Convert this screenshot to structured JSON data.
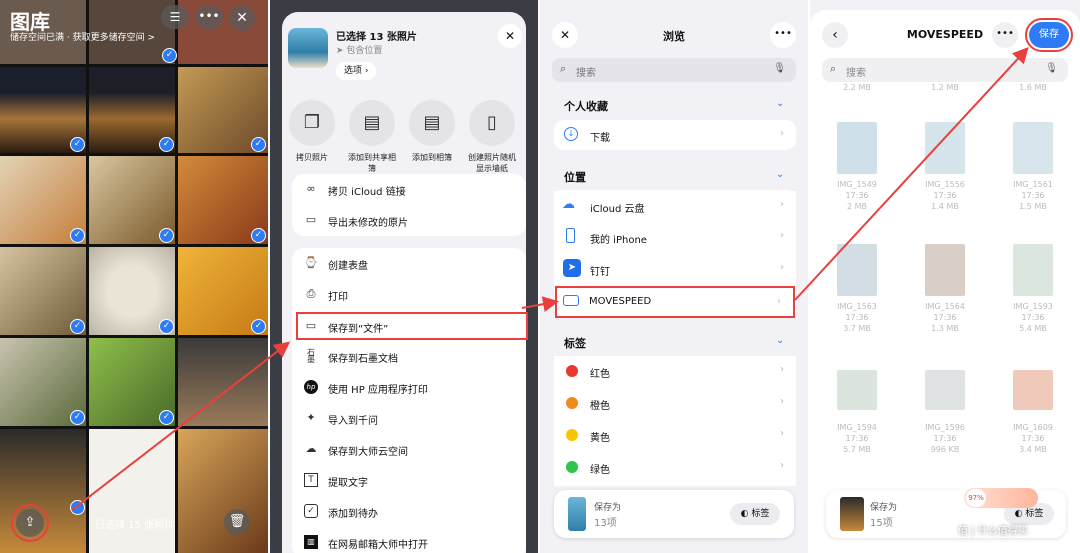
{
  "colors": {
    "accent": "#2e7bf6",
    "highlight": "#e9403d"
  },
  "gallery": {
    "title": "图库",
    "storage_notice": "储存空间已满 · 获取更多储存空间 >",
    "selected_label": "已选择 15 张照片",
    "menu_icon": "list-icon",
    "more_icon": "ellipsis-icon",
    "close_icon": "close-icon",
    "share_icon": "share-icon",
    "trash_icon": "trash-icon"
  },
  "share": {
    "title": "已选择 13 张照片",
    "location": "包含位置",
    "options_label": "选项",
    "actions": [
      {
        "label": "拷贝照片",
        "icon": "copy-icon"
      },
      {
        "label": "添加到共享相簿",
        "icon": "shared-album-icon"
      },
      {
        "label": "添加到相簿",
        "icon": "album-icon"
      },
      {
        "label": "创建照片随机显示墙纸",
        "icon": "phone-icon"
      }
    ],
    "group1": [
      "拷贝 iCloud 链接",
      "导出未修改的原片"
    ],
    "group2": [
      "创建表盘",
      "打印",
      "保存到“文件”",
      "保存到石墨文档",
      "使用 HP 应用程序打印",
      "导入到千问",
      "保存到大师云空间",
      "提取文字",
      "添加到待办",
      "在网易邮箱大师中打开"
    ]
  },
  "browse": {
    "title": "浏览",
    "search_placeholder": "搜索",
    "favorites_header": "个人收藏",
    "favorites": [
      "下载"
    ],
    "locations_header": "位置",
    "locations": [
      "iCloud 云盘",
      "我的 iPhone",
      "钉钉",
      "MOVESPEED"
    ],
    "tags_header": "标签",
    "tags": [
      {
        "label": "红色",
        "color": "#e8392f"
      },
      {
        "label": "橙色",
        "color": "#f2891b"
      },
      {
        "label": "黄色",
        "color": "#f7c600"
      },
      {
        "label": "绿色",
        "color": "#2ec54b"
      }
    ],
    "save_as_label": "保存为",
    "save_count": "13项",
    "tag_button": "标签"
  },
  "folder": {
    "title": "MOVESPEED",
    "save_button": "保存",
    "search_placeholder": "搜索",
    "top_partial": [
      "2.2 MB",
      "1.2 MB",
      "1.6 MB"
    ],
    "files": [
      {
        "name": "IMG_1549",
        "time": "17:36",
        "size": "2 MB",
        "color": "#cfe0ea"
      },
      {
        "name": "IMG_1556",
        "time": "17:36",
        "size": "1.4 MB",
        "color": "#d6e4ec"
      },
      {
        "name": "IMG_1561",
        "time": "17:36",
        "size": "1.5 MB",
        "color": "#d9e5ec"
      },
      {
        "name": "IMG_1563",
        "time": "17:36",
        "size": "3.7 MB",
        "color": "#d2dde4"
      },
      {
        "name": "IMG_1564",
        "time": "17:36",
        "size": "1.3 MB",
        "color": "#d9cfc6"
      },
      {
        "name": "IMG_1593",
        "time": "17:36",
        "size": "5.4 MB",
        "color": "#dbe6de"
      },
      {
        "name": "IMG_1594",
        "time": "17:36",
        "size": "5.7 MB",
        "color": "#dbe4dd"
      },
      {
        "name": "IMG_1596",
        "time": "17:36",
        "size": "996 KB",
        "color": "#e0e3e3"
      },
      {
        "name": "IMG_1609",
        "time": "17:36",
        "size": "3.4 MB",
        "color": "#efc9b9"
      }
    ],
    "save_as_label": "保存为",
    "save_count": "15项",
    "tag_button": "标签",
    "progress_badge": "97%"
  },
  "watermark": "值 | 什么值得买"
}
